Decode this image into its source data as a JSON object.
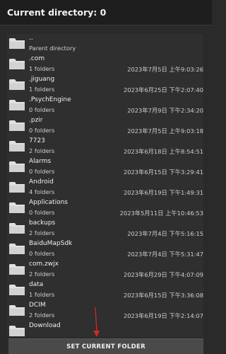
{
  "title": "Current directory: 0",
  "parent": {
    "name": "..",
    "label": "Parent directory"
  },
  "items": [
    {
      "name": ".com",
      "count": "1 folders",
      "date": "2023年7月5日 上午9:03:26"
    },
    {
      "name": ".jiguang",
      "count": "1 folders",
      "date": "2023年6月25日 下午2:07:40"
    },
    {
      "name": ".PsychEngine",
      "count": "0 folders",
      "date": "2023年7月9日 下午2:34:20"
    },
    {
      "name": ".pzir",
      "count": "0 folders",
      "date": "2023年7月5日 上午9:03:18"
    },
    {
      "name": "7723",
      "count": "2 folders",
      "date": "2023年6月18日 上午8:54:51"
    },
    {
      "name": "Alarms",
      "count": "0 folders",
      "date": "2023年6月15日 下午3:29:41"
    },
    {
      "name": "Android",
      "count": "4 folders",
      "date": "2023年6月19日 下午1:49:31"
    },
    {
      "name": "Applications",
      "count": "0 folders",
      "date": "2023年5月11日 上午10:46:53"
    },
    {
      "name": "backups",
      "count": "2 folders",
      "date": "2023年7月4日 下午5:16:15"
    },
    {
      "name": "BaiduMapSdk",
      "count": "0 folders",
      "date": "2023年7月4日 下午5:31:47"
    },
    {
      "name": "com.zwjx",
      "count": "2 folders",
      "date": "2023年6月29日 下午4:07:09"
    },
    {
      "name": "data",
      "count": "1 folders",
      "date": "2023年6月15日 下午3:36:08"
    },
    {
      "name": "DCIM",
      "count": "2 folders",
      "date": "2023年6月19日 下午2:14:07"
    },
    {
      "name": "Download",
      "count": "",
      "date": ""
    }
  ],
  "button": {
    "label": "SET CURRENT FOLDER"
  },
  "colors": {
    "background": "#2a2a2a",
    "folder": "#e0e0e0",
    "arrow": "#d8281e",
    "button": "#4a4a4a"
  },
  "icons": {
    "folder": "folder-icon",
    "arrow": "arrow-down-icon"
  }
}
